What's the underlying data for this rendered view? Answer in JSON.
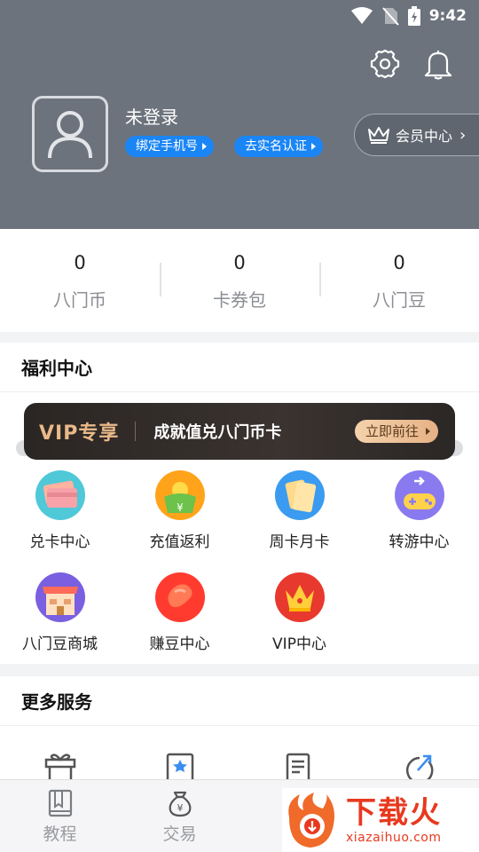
{
  "status_bar": {
    "time": "9:42"
  },
  "header": {
    "username": "未登录",
    "bind_phone": "绑定手机号",
    "real_name": "去实名认证",
    "vip_center": "会员中心"
  },
  "stats": [
    {
      "value": "0",
      "label": "八门币"
    },
    {
      "value": "0",
      "label": "卡券包"
    },
    {
      "value": "0",
      "label": "八门豆"
    }
  ],
  "welfare": {
    "title": "福利中心",
    "banner": {
      "tag": "VIP专享",
      "text": "成就值兑八门币卡",
      "button": "立即前往"
    },
    "items": [
      {
        "label": "兑卡中心",
        "icon": "card-exchange-icon"
      },
      {
        "label": "充值返利",
        "icon": "recharge-rebate-icon"
      },
      {
        "label": "周卡月卡",
        "icon": "weekly-monthly-card-icon"
      },
      {
        "label": "转游中心",
        "icon": "game-transfer-icon"
      },
      {
        "label": "八门豆商城",
        "icon": "bean-mall-icon"
      },
      {
        "label": "赚豆中心",
        "icon": "earn-beans-icon"
      },
      {
        "label": "VIP中心",
        "icon": "vip-crown-icon"
      }
    ]
  },
  "more": {
    "title": "更多服务"
  },
  "bottom_nav": [
    {
      "label": "教程",
      "icon": "book-icon"
    },
    {
      "label": "交易",
      "icon": "money-bag-icon"
    }
  ],
  "watermark": {
    "big": "下载火",
    "small": "xiazaihuo.com"
  }
}
